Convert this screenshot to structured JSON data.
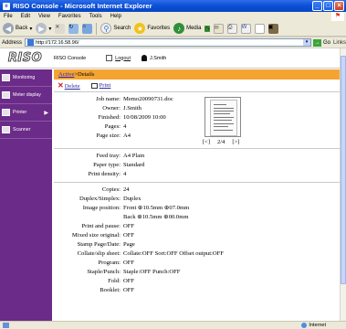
{
  "window": {
    "title": "RISO Console - Microsoft Internet Explorer"
  },
  "menu": [
    "File",
    "Edit",
    "View",
    "Favorites",
    "Tools",
    "Help"
  ],
  "toolbar": {
    "back": "Back",
    "search": "Search",
    "favorites": "Favorites",
    "media": "Media"
  },
  "address": {
    "label": "Address",
    "url": "http://172.16.58.96/",
    "go": "Go",
    "links": "Links"
  },
  "header": {
    "logo": "RISO",
    "title": "RISO Console",
    "logout": "Logout",
    "user": "J.Smith"
  },
  "sidebar": {
    "items": [
      {
        "label": "Monitoring",
        "icon": "monitor-icon"
      },
      {
        "label": "Meter display",
        "icon": "meter-icon"
      },
      {
        "label": "Printer",
        "icon": "printer-icon",
        "arrow": "▶"
      },
      {
        "label": "Scanner",
        "icon": "scanner-icon"
      }
    ]
  },
  "breadcrumb": {
    "link": "Active",
    "current": ">Details"
  },
  "actions": {
    "delete": "Delete",
    "print": "Print"
  },
  "job": {
    "rows": [
      {
        "label": "Job name:",
        "value": "Memo20090731.doc"
      },
      {
        "label": "Owner:",
        "value": "J.Smith"
      },
      {
        "label": "Finished:",
        "value": "10/08/2009 10:00"
      },
      {
        "label": "Pages:",
        "value": "4"
      },
      {
        "label": "Page size:",
        "value": "A4"
      }
    ],
    "pager": {
      "prev": "[<]",
      "position": "2/4",
      "next": "[>]"
    }
  },
  "paper": {
    "rows": [
      {
        "label": "Feed tray:",
        "value": "A4 Plain"
      },
      {
        "label": "Paper type:",
        "value": "Standard"
      },
      {
        "label": "Print density:",
        "value": "4"
      }
    ]
  },
  "settings": {
    "rows": [
      {
        "label": "Copies:",
        "value": "24"
      },
      {
        "label": "Duplex/Simplex:",
        "value": "Duplex"
      },
      {
        "label": "Image position:",
        "value": "Front  ⊕10.5mm  ⊕07.0mm"
      },
      {
        "label": "",
        "value": "Back   ⊕10.5mm  ⊕00.0mm"
      },
      {
        "label": "Print and pause:",
        "value": "OFF"
      },
      {
        "label": "Mixed size original:",
        "value": "OFF"
      },
      {
        "label": "Stamp Page/Date:",
        "value": "Page"
      },
      {
        "label": "Collate/slip sheet:",
        "value": "Collate:OFF  Sort:OFF  Offset output:OFF"
      },
      {
        "label": "Program:",
        "value": "OFF"
      },
      {
        "label": "Staple/Punch:",
        "value": "Staple:OFF  Punch:OFF"
      },
      {
        "label": "Fold:",
        "value": "OFF"
      },
      {
        "label": "Booklet:",
        "value": "OFF"
      }
    ]
  },
  "status": {
    "zone": "Internet"
  }
}
